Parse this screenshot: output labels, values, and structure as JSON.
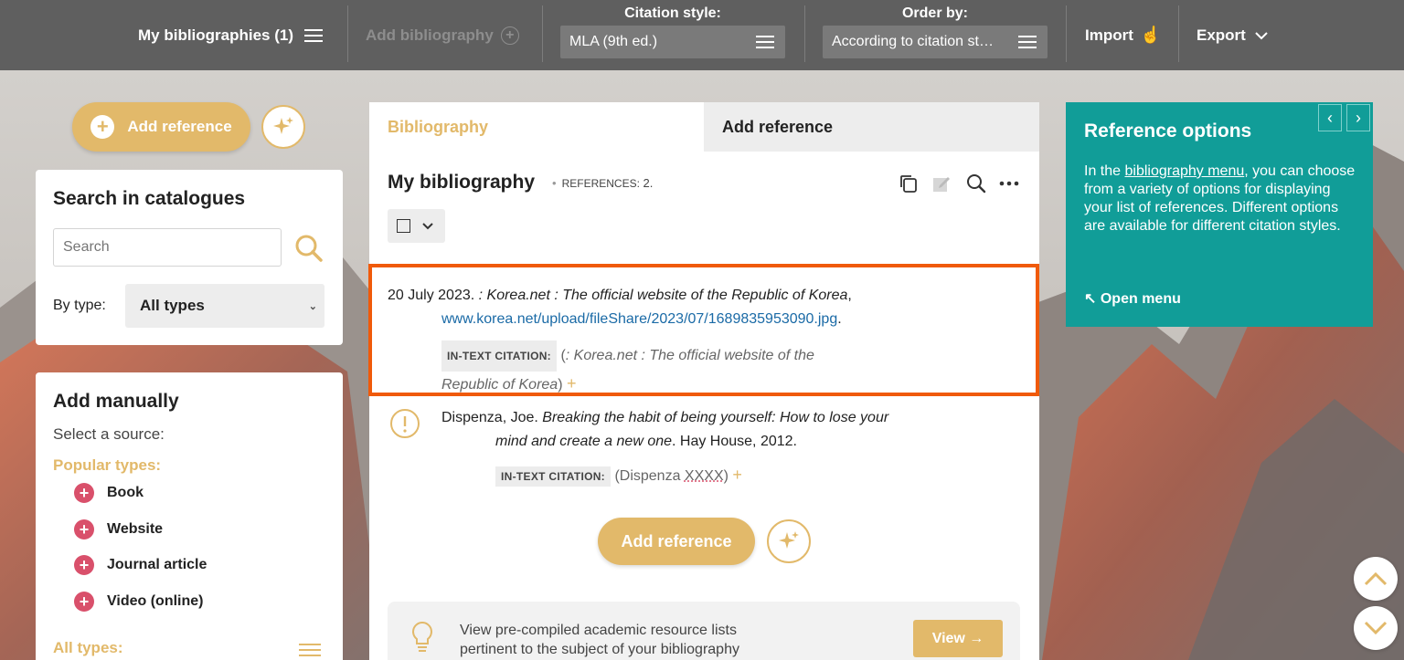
{
  "topbar": {
    "my_bibliographies": "My bibliographies (1)",
    "add_bibliography": "Add bibliography",
    "citation_style_label": "Citation style:",
    "citation_style_value": "MLA (9th ed.)",
    "order_by_label": "Order by:",
    "order_by_value": "According to citation st…",
    "import_label": "Import",
    "export_label": "Export"
  },
  "left": {
    "add_reference": "Add reference",
    "search_title": "Search in catalogues",
    "search_placeholder": "Search",
    "by_type_label": "By type:",
    "by_type_value": "All types",
    "manual_title": "Add manually",
    "select_source": "Select a source:",
    "popular_types": "Popular types:",
    "types": [
      "Book",
      "Website",
      "Journal article",
      "Video (online)"
    ],
    "all_types": "All types:"
  },
  "main": {
    "tabs": [
      "Bibliography",
      "Add reference"
    ],
    "title": "My bibliography",
    "references_label": "References:",
    "references_count": "2.",
    "entry1": {
      "date": "20 July 2023. ",
      "title": ": Korea.net : The official website of the Republic of Korea",
      "comma": ",",
      "url": "www.korea.net/upload/fileShare/2023/07/1689835953090.jpg",
      "dot": ".",
      "intext_label": "In-text citation:",
      "intext_open": "(",
      "intext_text": ": Korea.net : The official website of the Republic of Korea",
      "intext_close": ")"
    },
    "entry2": {
      "author": "Dispenza, Joe. ",
      "title": "Breaking the habit of being yourself: How to lose your mind and create a new one",
      "rest": ". Hay House, 2012.",
      "intext_label": "In-text citation:",
      "intext_text": "(Dispenza ",
      "intext_xxxx": "XXXX",
      "intext_close": ")"
    },
    "add_reference": "Add reference",
    "tip_text": "View pre-compiled academic resource lists pertinent to the subject of your bibliography",
    "view_button": "View →"
  },
  "options": {
    "title": "Reference options",
    "body_pre": "In the ",
    "body_link": "bibliography menu",
    "body_post": ", you can choose from a variety of options for displaying your list of references. Different options are available for different citation styles.",
    "open_menu": "↖ Open menu"
  },
  "colors": {
    "accent": "#e2b96a",
    "teal": "#119d98",
    "highlight": "#f05a0a",
    "topbar": "#5f5f5f"
  }
}
